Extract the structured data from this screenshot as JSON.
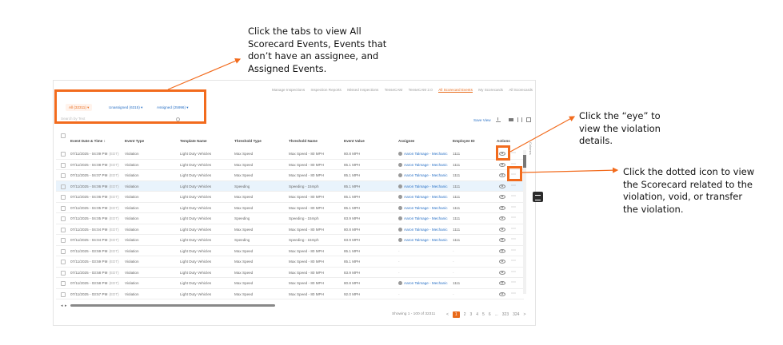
{
  "callouts": {
    "tabs": "Click the tabs to view All Scorecard Events, Events that don’t have an assignee, and Assigned Events.",
    "eye": "Click the “eye” to view the violation details.",
    "dots": "Click the dotted icon to view the Scorecard related to the violation, void, or transfer the violation."
  },
  "nav_tabs": [
    "Manage Inspections",
    "Inspection Reports",
    "Missed Inspections",
    "TenseCAM",
    "TenseCAM 2.0",
    "All Scorecard Events",
    "My Scorecards",
    "All Scorecards"
  ],
  "filter_tabs": {
    "all": "All (32311) ▾",
    "unassigned": "Unassigned (6315) ▾",
    "assigned": "Assigned (25996) ▾"
  },
  "search": {
    "placeholder": "Search by Text"
  },
  "toolbar": {
    "save_view": "Save View"
  },
  "columns_label": "Columns",
  "table": {
    "headers": [
      "Event Date & Time ↕",
      "Event Type",
      "Template Name",
      "Threshold Type",
      "Threshold Name",
      "Event Value",
      "Assignee",
      "Employee ID",
      "Actions"
    ],
    "rows": [
      {
        "date": "07/11/2025 - 04:09 PM",
        "tz": "(EDT)",
        "type": "Violation",
        "template": "Light Duty Vehicles",
        "ttype": "Max Speed",
        "tname": "Max Speed - 80 MPH",
        "value": "80.8 MPH",
        "assignee": "Aaron Talmage - Mechanic",
        "emp": "1111"
      },
      {
        "date": "07/11/2025 - 04:08 PM",
        "tz": "(EDT)",
        "type": "Violation",
        "template": "Light Duty Vehicles",
        "ttype": "Max Speed",
        "tname": "Max Speed - 80 MPH",
        "value": "85.1 MPH",
        "assignee": "Aaron Talmage - Mechanic",
        "emp": "1111"
      },
      {
        "date": "07/11/2025 - 04:07 PM",
        "tz": "(EDT)",
        "type": "Violation",
        "template": "Light Duty Vehicles",
        "ttype": "Max Speed",
        "tname": "Max Speed - 80 MPH",
        "value": "85.1 MPH",
        "assignee": "Aaron Talmage - Mechanic",
        "emp": "1111"
      },
      {
        "date": "07/11/2025 - 04:06 PM",
        "tz": "(EDT)",
        "type": "Violation",
        "template": "Light Duty Vehicles",
        "ttype": "Speeding",
        "tname": "Speeding - 15mph",
        "value": "85.1 MPH",
        "assignee": "Aaron Talmage - Mechanic",
        "emp": "1111"
      },
      {
        "date": "07/11/2025 - 04:06 PM",
        "tz": "(EDT)",
        "type": "Violation",
        "template": "Light Duty Vehicles",
        "ttype": "Max Speed",
        "tname": "Max Speed - 80 MPH",
        "value": "85.1 MPH",
        "assignee": "Aaron Talmage - Mechanic",
        "emp": "1111"
      },
      {
        "date": "07/11/2025 - 04:05 PM",
        "tz": "(EDT)",
        "type": "Violation",
        "template": "Light Duty Vehicles",
        "ttype": "Max Speed",
        "tname": "Max Speed - 80 MPH",
        "value": "85.1 MPH",
        "assignee": "Aaron Talmage - Mechanic",
        "emp": "1111"
      },
      {
        "date": "07/11/2025 - 04:05 PM",
        "tz": "(EDT)",
        "type": "Violation",
        "template": "Light Duty Vehicles",
        "ttype": "Speeding",
        "tname": "Speeding - 15mph",
        "value": "83.9 MPH",
        "assignee": "Aaron Talmage - Mechanic",
        "emp": "1111"
      },
      {
        "date": "07/11/2025 - 04:04 PM",
        "tz": "(EDT)",
        "type": "Violation",
        "template": "Light Duty Vehicles",
        "ttype": "Max Speed",
        "tname": "Max Speed - 80 MPH",
        "value": "80.8 MPH",
        "assignee": "Aaron Talmage - Mechanic",
        "emp": "1111"
      },
      {
        "date": "07/11/2025 - 04:04 PM",
        "tz": "(EDT)",
        "type": "Violation",
        "template": "Light Duty Vehicles",
        "ttype": "Speeding",
        "tname": "Speeding - 15mph",
        "value": "83.9 MPH",
        "assignee": "Aaron Talmage - Mechanic",
        "emp": "1111"
      },
      {
        "date": "07/11/2025 - 03:59 PM",
        "tz": "(EDT)",
        "type": "Violation",
        "template": "Light Duty Vehicles",
        "ttype": "Max Speed",
        "tname": "Max Speed - 80 MPH",
        "value": "85.1 MPH",
        "assignee": "-",
        "emp": "-"
      },
      {
        "date": "07/11/2025 - 03:59 PM",
        "tz": "(EDT)",
        "type": "Violation",
        "template": "Light Duty Vehicles",
        "ttype": "Max Speed",
        "tname": "Max Speed - 80 MPH",
        "value": "85.1 MPH",
        "assignee": "-",
        "emp": "-"
      },
      {
        "date": "07/11/2025 - 03:58 PM",
        "tz": "(EDT)",
        "type": "Violation",
        "template": "Light Duty Vehicles",
        "ttype": "Max Speed",
        "tname": "Max Speed - 80 MPH",
        "value": "83.9 MPH",
        "assignee": "-",
        "emp": "-"
      },
      {
        "date": "07/11/2025 - 03:58 PM",
        "tz": "(EDT)",
        "type": "Violation",
        "template": "Light Duty Vehicles",
        "ttype": "Max Speed",
        "tname": "Max Speed - 80 MPH",
        "value": "80.8 MPH",
        "assignee": "Aaron Talmage - Mechanic",
        "emp": "1111"
      },
      {
        "date": "07/11/2025 - 03:57 PM",
        "tz": "(EDT)",
        "type": "Violation",
        "template": "Light Duty Vehicles",
        "ttype": "Max Speed",
        "tname": "Max Speed - 80 MPH",
        "value": "92.0 MPH",
        "assignee": "-",
        "emp": "-"
      }
    ],
    "selected_row": 3
  },
  "pager": {
    "info": "Showing 1 - 100 of 32311",
    "prev": "<",
    "pages": [
      "1",
      "2",
      "3",
      "4",
      "5",
      "6",
      "...",
      "323",
      "324"
    ],
    "next": ">"
  },
  "colors": {
    "accent": "#f26b1d",
    "link": "#2b72c6",
    "selected_row": "#e9f3fc"
  }
}
